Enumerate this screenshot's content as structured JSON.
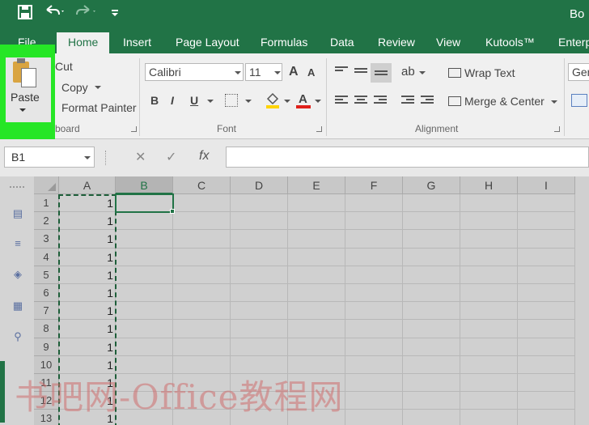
{
  "titlebar": {
    "title": "Bo",
    "save_icon": "save-icon",
    "undo_icon": "undo-icon",
    "redo_icon": "redo-icon",
    "customize_icon": "customize-icon"
  },
  "tabs": [
    "File",
    "Home",
    "Insert",
    "Page Layout",
    "Formulas",
    "Data",
    "Review",
    "View",
    "Kutools™",
    "Enterp"
  ],
  "active_tab": "Home",
  "clipboard": {
    "paste": "Paste",
    "cut": "Cut",
    "copy": "Copy",
    "format_painter": "Format Painter",
    "group_label": "board"
  },
  "font": {
    "name": "Calibri",
    "size": "11",
    "grow": "A",
    "shrink": "A",
    "bold": "B",
    "italic": "I",
    "underline": "U",
    "font_color": "A",
    "group_label": "Font"
  },
  "alignment": {
    "wrap_text": "Wrap Text",
    "merge_center": "Merge & Center",
    "group_label": "Alignment"
  },
  "number": {
    "format": "Gen"
  },
  "formula_bar": {
    "name_box": "B1",
    "fx": "fx",
    "cancel": "✕",
    "enter": "✓",
    "formula": ""
  },
  "columns": [
    "A",
    "B",
    "C",
    "D",
    "E",
    "F",
    "G",
    "H",
    "I"
  ],
  "selected_column": "B",
  "rows": [
    "1",
    "2",
    "3",
    "4",
    "5",
    "6",
    "7",
    "8",
    "9",
    "10",
    "11",
    "12",
    "13"
  ],
  "column_a_values": [
    "1",
    "1",
    "1",
    "1",
    "1",
    "1",
    "1",
    "1",
    "1",
    "1",
    "1",
    "1",
    "1"
  ],
  "watermark": "书吧网-Office教程网",
  "colors": {
    "accent": "#217346",
    "highlight": "#26e626",
    "ribbon": "#f0f0f0"
  }
}
